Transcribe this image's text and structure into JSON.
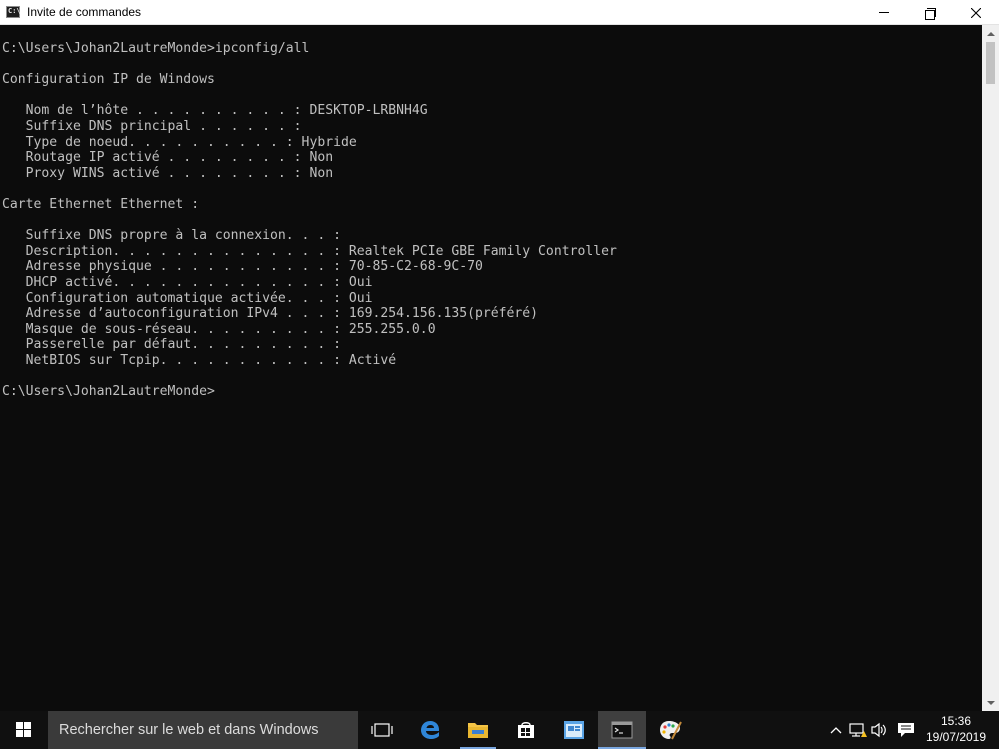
{
  "window": {
    "title": "Invite de commandes",
    "icon_text": "C:\\"
  },
  "console": {
    "lines": [
      "C:\\Users\\Johan2LautreMonde>ipconfig/all",
      "",
      "Configuration IP de Windows",
      "",
      "   Nom de l’hôte . . . . . . . . . . : DESKTOP-LRBNH4G",
      "   Suffixe DNS principal . . . . . . :",
      "   Type de noeud. . . . . . . . . . : Hybride",
      "   Routage IP activé . . . . . . . . : Non",
      "   Proxy WINS activé . . . . . . . . : Non",
      "",
      "Carte Ethernet Ethernet :",
      "",
      "   Suffixe DNS propre à la connexion. . . :",
      "   Description. . . . . . . . . . . . . . : Realtek PCIe GBE Family Controller",
      "   Adresse physique . . . . . . . . . . . : 70-85-C2-68-9C-70",
      "   DHCP activé. . . . . . . . . . . . . . : Oui",
      "   Configuration automatique activée. . . : Oui",
      "   Adresse d’autoconfiguration IPv4 . . . : 169.254.156.135(préféré)",
      "   Masque de sous-réseau. . . . . . . . . : 255.255.0.0",
      "   Passerelle par défaut. . . . . . . . . :",
      "   NetBIOS sur Tcpip. . . . . . . . . . . : Activé",
      "",
      "C:\\Users\\Johan2LautreMonde>"
    ]
  },
  "taskbar": {
    "search_placeholder": "Rechercher sur le web et dans Windows",
    "clock": {
      "time": "15:36",
      "date": "19/07/2019"
    },
    "pinned": [
      {
        "name": "task-view",
        "icon": "task-view-icon"
      },
      {
        "name": "edge",
        "icon": "edge-icon"
      },
      {
        "name": "file-explorer",
        "icon": "folder-icon"
      },
      {
        "name": "store",
        "icon": "store-icon"
      },
      {
        "name": "app",
        "icon": "app-window-icon"
      },
      {
        "name": "command-prompt",
        "icon": "cmd-icon",
        "active": true
      },
      {
        "name": "paint",
        "icon": "paint-icon"
      }
    ]
  },
  "colors": {
    "console_bg": "#0c0c0c",
    "console_text": "#c0c0c0",
    "taskbar_bg": "#101010",
    "accent": "#7aa7e0"
  }
}
